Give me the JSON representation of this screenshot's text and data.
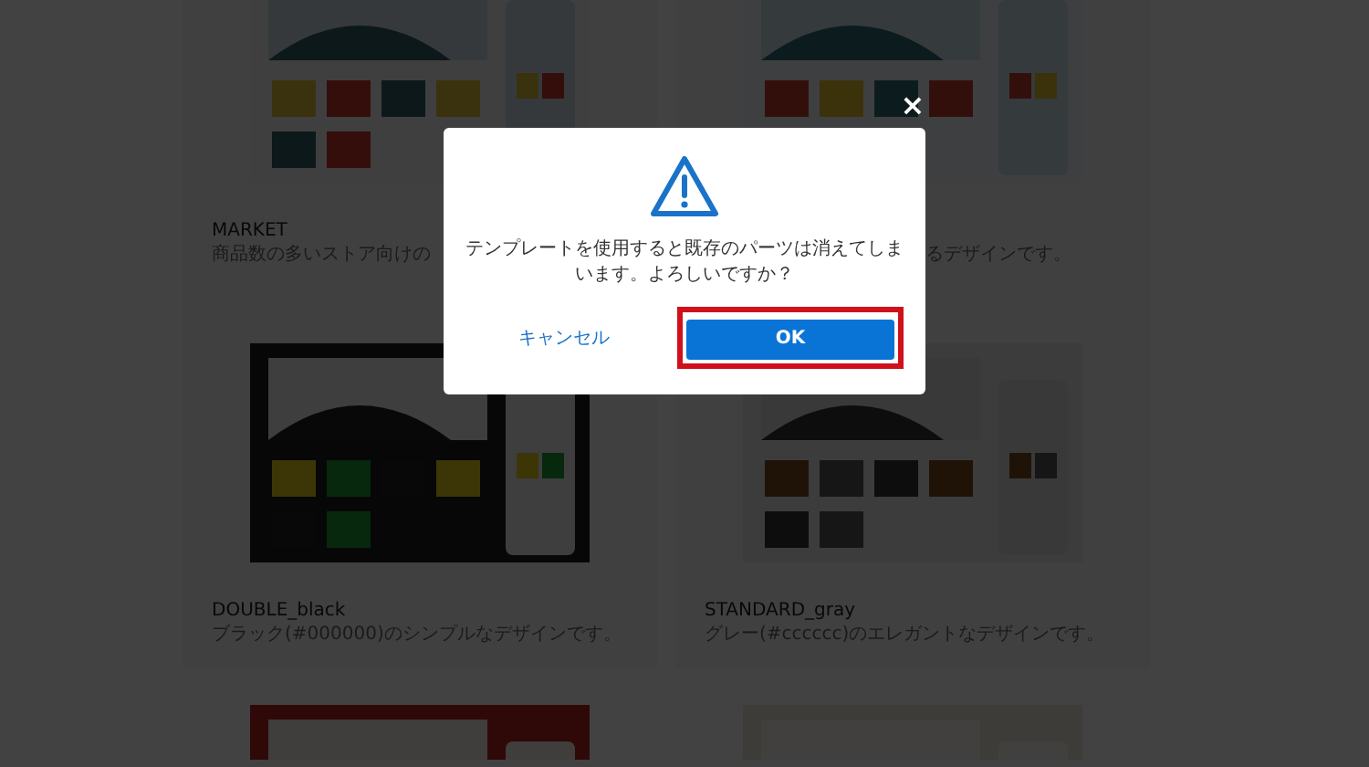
{
  "templates": [
    {
      "name": "MARKET",
      "description": "商品数の多いストア向けの",
      "kind": "full"
    },
    {
      "description": "るデザインです。",
      "kind": "tail"
    },
    {
      "name": "DOUBLE_black",
      "description": "ブラック(#000000)のシンプルなデザインです。",
      "kind": "full"
    },
    {
      "name": "STANDARD_gray",
      "description": "グレー(#cccccc)のエレガントなデザインです。",
      "kind": "full"
    },
    {
      "kind": "peek"
    },
    {
      "kind": "peek"
    }
  ],
  "dialog": {
    "message": "テンプレートを使用すると既存のパーツは消えてしまいます。よろしいですか？",
    "cancel": "キャンセル",
    "ok": {
      "label": "OK",
      "highlighted": true
    },
    "close": "×"
  }
}
